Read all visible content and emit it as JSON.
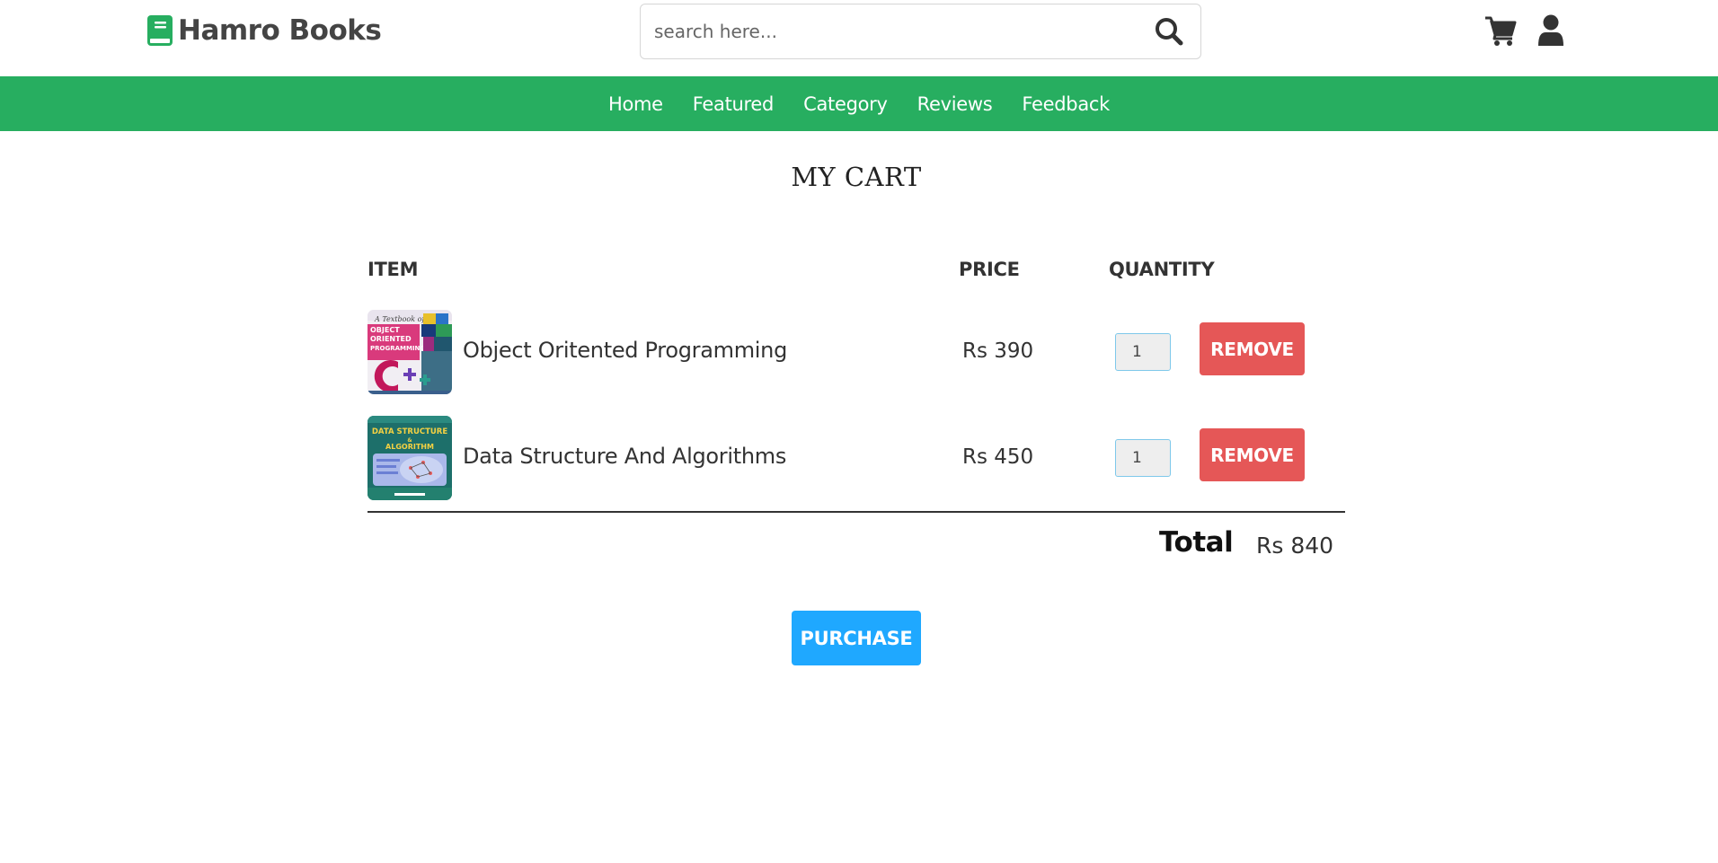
{
  "brand": {
    "name": "Hamro Books",
    "icon": "book-icon",
    "accent_color": "#27ae60"
  },
  "search": {
    "placeholder": "search here...",
    "value": "",
    "icon": "search-icon"
  },
  "header_icons": [
    "cart-icon",
    "user-icon"
  ],
  "nav": {
    "items": [
      {
        "label": "Home"
      },
      {
        "label": "Featured"
      },
      {
        "label": "Category"
      },
      {
        "label": "Reviews"
      },
      {
        "label": "Feedback"
      }
    ]
  },
  "cart": {
    "title": "MY CART",
    "columns": {
      "item": "ITEM",
      "price": "PRICE",
      "quantity": "QUANTITY"
    },
    "items": [
      {
        "name": "Object Oritented Programming",
        "price": "Rs 390",
        "quantity": "1",
        "remove_label": "REMOVE"
      },
      {
        "name": "Data Structure And Algorithms",
        "price": "Rs 450",
        "quantity": "1",
        "remove_label": "REMOVE"
      }
    ],
    "total_label": "Total",
    "total_value": "Rs 840",
    "purchase_label": "PURCHASE"
  },
  "colors": {
    "remove_button": "#e55757",
    "purchase_button": "#1fa8ff",
    "nav_bar": "#27ae60"
  }
}
